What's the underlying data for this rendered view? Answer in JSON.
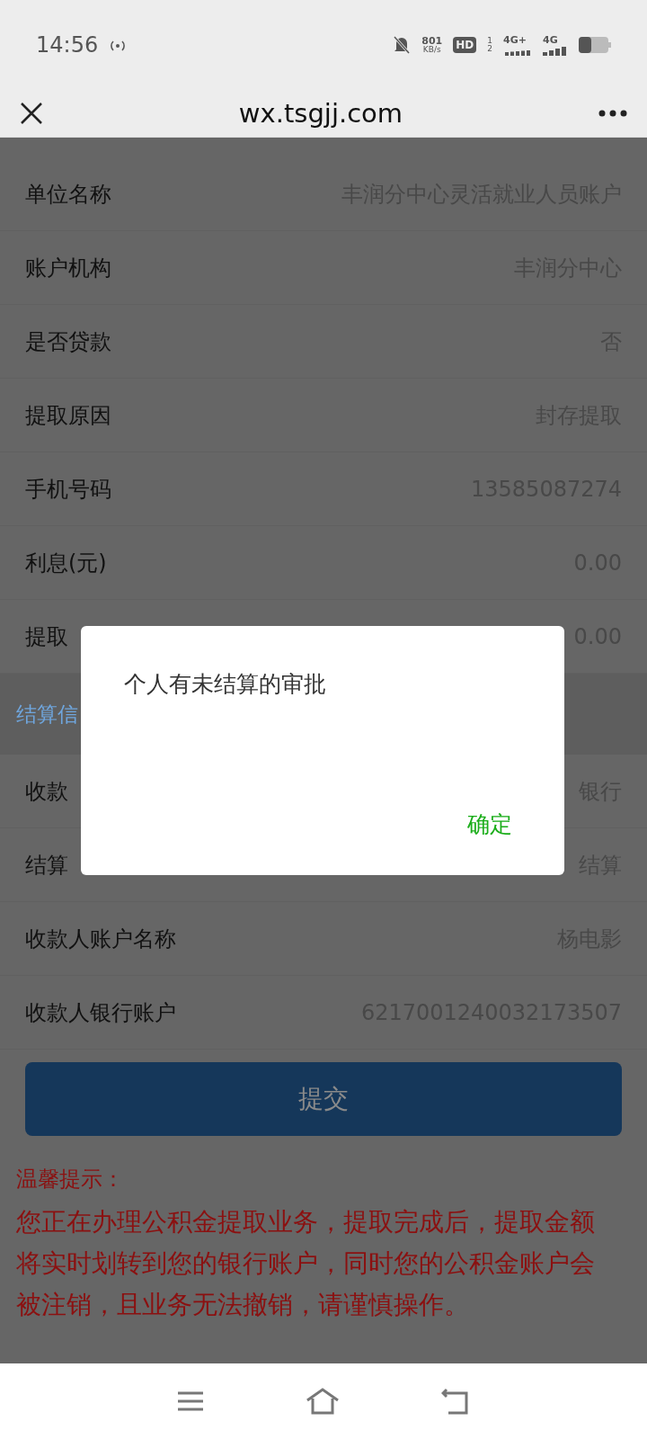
{
  "status_bar": {
    "time": "14:56",
    "speed_value": "801",
    "speed_unit": "KB/s",
    "hd": "HD",
    "sim_1": "1",
    "sim_2": "2",
    "network_1": "4G+",
    "network_2": "4G"
  },
  "nav": {
    "title": "wx.tsgjj.com"
  },
  "rows": [
    {
      "label": "单位名称",
      "value": "丰润分中心灵活就业人员账户"
    },
    {
      "label": "账户机构",
      "value": "丰润分中心"
    },
    {
      "label": "是否贷款",
      "value": "否"
    },
    {
      "label": "提取原因",
      "value": "封存提取"
    },
    {
      "label": "手机号码",
      "value": "13585087274"
    },
    {
      "label": "利息(元)",
      "value": "0.00"
    },
    {
      "label": "提取",
      "value": "0.00"
    }
  ],
  "section": {
    "title": "结算信"
  },
  "settlement_rows": [
    {
      "label": "收款",
      "value": "银行"
    },
    {
      "label": "结算",
      "value": "结算"
    },
    {
      "label": "收款人账户名称",
      "value": "杨电影"
    },
    {
      "label": "收款人银行账户",
      "value": "6217001240032173507"
    }
  ],
  "submit_button": "提交",
  "tips": {
    "title": "温馨提示：",
    "body": "您正在办理公积金提取业务，提取完成后，提取金额将实时划转到您的银行账户，同时您的公积金账户会被注销，且业务无法撤销，请谨慎操作。"
  },
  "dialog": {
    "message": "个人有未结算的审批",
    "confirm": "确定"
  }
}
